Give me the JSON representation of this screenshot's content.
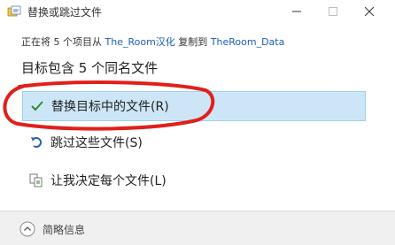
{
  "window": {
    "title": "替换或跳过文件",
    "icons": [
      "file-copy-icon",
      "minimize-icon",
      "maximize-icon",
      "close-icon"
    ]
  },
  "info": {
    "prefix": "正在将 5 个项目从 ",
    "source": "The_Room汉化",
    "middle": " 复制到 ",
    "destination": "TheRoom_Data"
  },
  "heading": "目标包含 5 个同名文件",
  "options": {
    "replace": {
      "label": "替换目标中的文件(R)",
      "icon": "checkmark-icon"
    },
    "skip": {
      "label": "跳过这些文件(S)",
      "icon": "skip-arrow-icon"
    },
    "decide": {
      "label": "让我决定每个文件(L)",
      "icon": "compare-files-icon"
    }
  },
  "footer": {
    "label": "简略信息",
    "icon": "chevron-up-icon"
  },
  "colors": {
    "accent": "#1a5fb4",
    "selection": "#cde6f7",
    "annotation": "#e0201b",
    "check": "#2e8b2e"
  }
}
